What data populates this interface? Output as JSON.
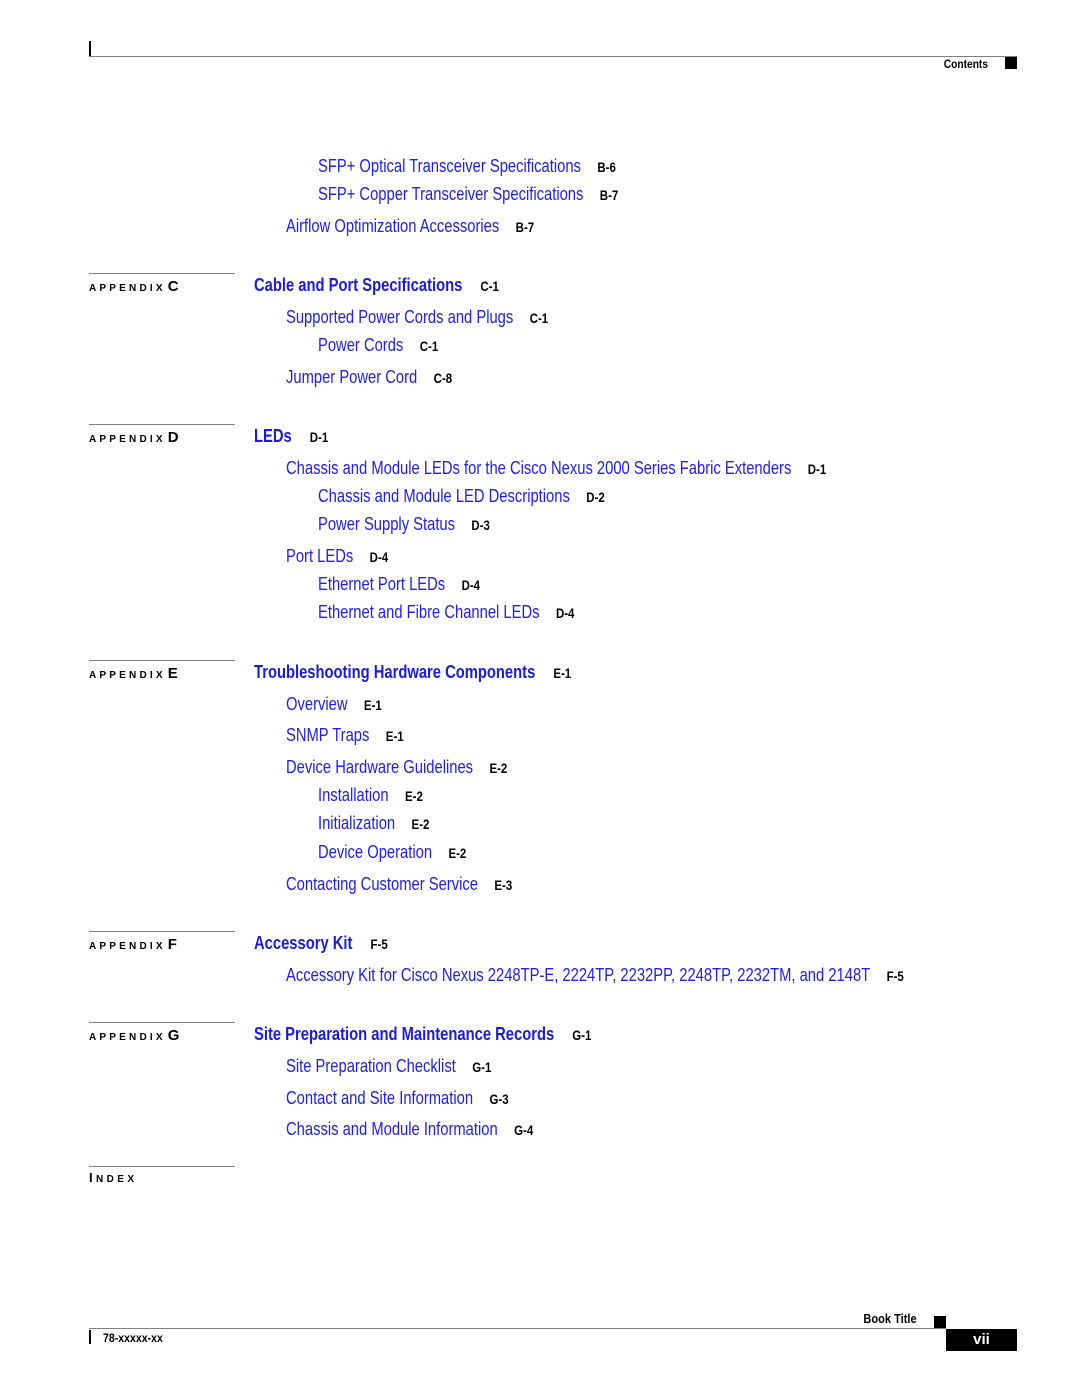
{
  "header": {
    "section_label": "Contents"
  },
  "toc": {
    "pre_items": [
      {
        "level": 3,
        "title": "SFP+ Optical Transceiver Specifications",
        "page": "B-6"
      },
      {
        "level": 3,
        "title": "SFP+ Copper Transceiver Specifications",
        "page": "B-7"
      },
      {
        "level": 2,
        "title": "Airflow Optimization Accessories",
        "page": "B-7"
      }
    ],
    "appendices": [
      {
        "prefix": "APPENDIX",
        "letter": "C",
        "title": "Cable and Port Specifications",
        "page": "C-1",
        "items": [
          {
            "level": 2,
            "title": "Supported Power Cords and Plugs",
            "page": "C-1"
          },
          {
            "level": 3,
            "title": "Power Cords",
            "page": "C-1"
          },
          {
            "level": 2,
            "title": "Jumper Power Cord",
            "page": "C-8"
          }
        ]
      },
      {
        "prefix": "APPENDIX",
        "letter": "D",
        "title": "LEDs",
        "page": "D-1",
        "items": [
          {
            "level": 2,
            "title": "Chassis and Module LEDs for the Cisco Nexus 2000 Series Fabric Extenders",
            "page": "D-1"
          },
          {
            "level": 3,
            "title": "Chassis and Module LED Descriptions",
            "page": "D-2"
          },
          {
            "level": 3,
            "title": "Power Supply Status",
            "page": "D-3"
          },
          {
            "level": 2,
            "title": "Port LEDs",
            "page": "D-4"
          },
          {
            "level": 3,
            "title": "Ethernet Port LEDs",
            "page": "D-4"
          },
          {
            "level": 3,
            "title": "Ethernet and Fibre Channel LEDs",
            "page": "D-4"
          }
        ]
      },
      {
        "prefix": "APPENDIX",
        "letter": "E",
        "title": "Troubleshooting Hardware Components",
        "page": "E-1",
        "items": [
          {
            "level": 2,
            "title": "Overview",
            "page": "E-1"
          },
          {
            "level": 2,
            "title": "SNMP Traps",
            "page": "E-1"
          },
          {
            "level": 2,
            "title": "Device Hardware Guidelines",
            "page": "E-2"
          },
          {
            "level": 3,
            "title": "Installation",
            "page": "E-2"
          },
          {
            "level": 3,
            "title": "Initialization",
            "page": "E-2"
          },
          {
            "level": 3,
            "title": "Device Operation",
            "page": "E-2"
          },
          {
            "level": 2,
            "title": "Contacting Customer Service",
            "page": "E-3"
          }
        ]
      },
      {
        "prefix": "APPENDIX",
        "letter": "F",
        "title": "Accessory Kit",
        "page": "F-5",
        "items": [
          {
            "level": 2,
            "title": "Accessory Kit for Cisco Nexus 2248TP-E, 2224TP, 2232PP, 2248TP, 2232TM, and 2148T",
            "page": "F-5"
          }
        ]
      },
      {
        "prefix": "APPENDIX",
        "letter": "G",
        "title": "Site Preparation and Maintenance Records",
        "page": "G-1",
        "items": [
          {
            "level": 2,
            "title": "Site Preparation Checklist",
            "page": "G-1"
          },
          {
            "level": 2,
            "title": "Contact and Site Information",
            "page": "G-3"
          },
          {
            "level": 2,
            "title": "Chassis and Module Information",
            "page": "G-4"
          }
        ]
      }
    ],
    "index": {
      "first": "I",
      "rest": "NDEX"
    }
  },
  "footer": {
    "book_title": "Book Title",
    "doc_number": "78-xxxxx-xx",
    "page_number": "vii"
  },
  "colors": {
    "link": "#2020e8",
    "chapter_link": "#1a1ae0",
    "text": "#000000",
    "rule": "#808080"
  }
}
